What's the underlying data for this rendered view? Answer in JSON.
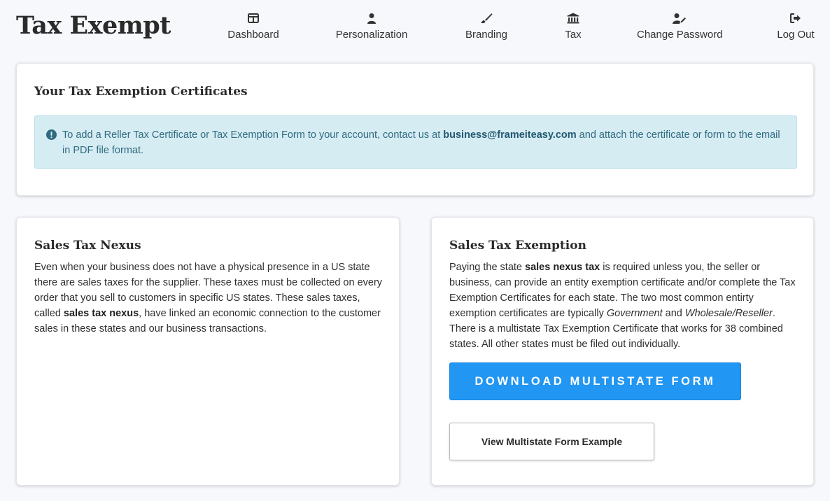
{
  "header": {
    "title": "Tax Exempt",
    "nav": [
      {
        "label": "Dashboard",
        "icon": "dashboard-icon"
      },
      {
        "label": "Personalization",
        "icon": "user-icon"
      },
      {
        "label": "Branding",
        "icon": "brush-icon"
      },
      {
        "label": "Tax",
        "icon": "bank-icon"
      },
      {
        "label": "Change Password",
        "icon": "user-edit-icon"
      },
      {
        "label": "Log Out",
        "icon": "logout-icon"
      }
    ]
  },
  "certificates": {
    "title": "Your Tax Exemption Certificates",
    "alert": {
      "icon": "exclamation-circle-icon",
      "text_before": "To add a Reller Tax Certificate or Tax Exemption Form to your account, contact us at ",
      "email": "business@frameiteasy.com",
      "text_after": " and attach the certificate or form to the email in PDF file format."
    }
  },
  "nexus": {
    "title": "Sales Tax Nexus",
    "text_before": "Even when your business does not have a physical presence in a US state there are sales taxes for the supplier. These taxes must be collected on every order that you sell to customers in specific US states. These sales taxes, called ",
    "bold": "sales tax nexus",
    "text_after": ", have linked an economic connection to the customer sales in these states and our business transactions."
  },
  "exemption": {
    "title": "Sales Tax Exemption",
    "text_1": "Paying the state ",
    "bold": "sales nexus tax",
    "text_2": " is required unless you, the seller or business, can provide an entity exemption certificate and/or complete the Tax Exemption Certificates for each state. The two most common entirty exemption certificates are typically ",
    "italic_1": "Government",
    "text_3": " and ",
    "italic_2": "Wholesale/Reseller",
    "text_4": ". There is a multistate Tax Exemption Certificate that works for 38 combined states. All other states must be filed out individually.",
    "download_button": "DOWNLOAD MULTISTATE FORM",
    "view_button": "View Multistate Form Example"
  },
  "colors": {
    "primary": "#2196f3",
    "alert_bg": "#d6ecf3",
    "alert_text": "#2f6b80",
    "page_bg": "#f6f8fc"
  }
}
